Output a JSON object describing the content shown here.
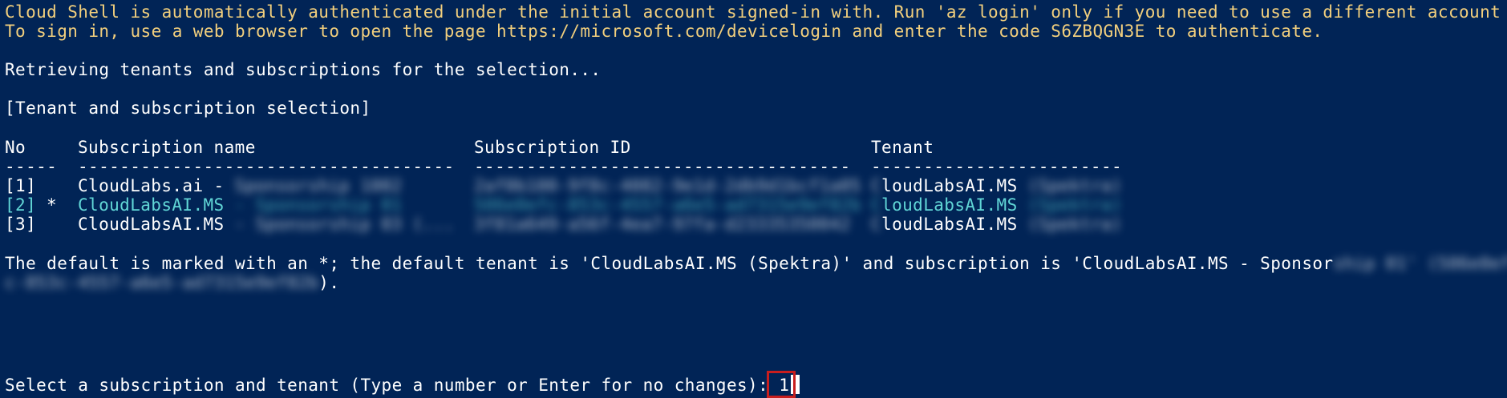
{
  "terminal": {
    "intro": [
      "Cloud Shell is automatically authenticated under the initial account signed-in with. Run 'az login' only if you need to use a different account",
      "To sign in, use a web browser to open the page https://microsoft.com/devicelogin and enter the code S6ZBQGN3E to authenticate."
    ],
    "retrieving": "Retrieving tenants and subscriptions for the selection...",
    "section_header": "[Tenant and subscription selection]",
    "table": {
      "headers": {
        "no": "No",
        "name": "Subscription name",
        "id": "Subscription ID",
        "tenant": "Tenant"
      },
      "dividers": {
        "no": "-----",
        "name": "------------------------------------",
        "id": "------------------------------------",
        "tenant": "------------------------"
      },
      "rows": [
        {
          "no": "[1]",
          "marker": "",
          "name": "CloudLabs.ai -",
          "name_redacted": " Sponsorship 1002",
          "id_redacted": "2af0b100-9f8c-4082-9e1d-2db9d1bcf1a05",
          "tenant_pre": "C",
          "tenant": "loudLabsAI.MS",
          "tenant_redacted": " (Spektra)",
          "selected_default": false
        },
        {
          "no": "[2]",
          "marker": "*",
          "name": "CloudLabsAI.MS",
          "name_redacted": " - Sponsorship 01",
          "id_redacted": "506e0efc-853c-4557-a6e5-ad7315e9ef82b",
          "tenant_pre": "C",
          "tenant": "loudLabsAI.MS",
          "tenant_redacted": " (Spektra)",
          "selected_default": true
        },
        {
          "no": "[3]",
          "marker": "",
          "name": "CloudLabsAI.MS",
          "name_redacted": " - Sponsorship 03 (...",
          "id_redacted": "3f81a649-a56f-4ea7-97fa-d23335350042",
          "tenant_pre": "C",
          "tenant": "loudLabsAI.MS",
          "tenant_redacted": " (Spektra)",
          "selected_default": false
        }
      ]
    },
    "default_line1": "The default is marked with an *; the default tenant is 'CloudLabsAI.MS (Spektra)' and subscription is 'CloudLabsAI.MS - Sponsor",
    "default_line1_redacted": "ship 01' (506e0ef",
    "default_line2_pre": "c",
    "default_line2_redacted": "-853c-4557-a6e5-ad7315e9ef82b",
    "default_line2_post": ").",
    "prompt": "Select a subscription and tenant (Type a number or Enter for no changes): ",
    "input_value": "1"
  },
  "colors": {
    "background": "#012456",
    "text": "#ffffff",
    "warning": "#f2cf7d",
    "highlight": "#61d6d6",
    "annotation": "#c81e1e"
  }
}
